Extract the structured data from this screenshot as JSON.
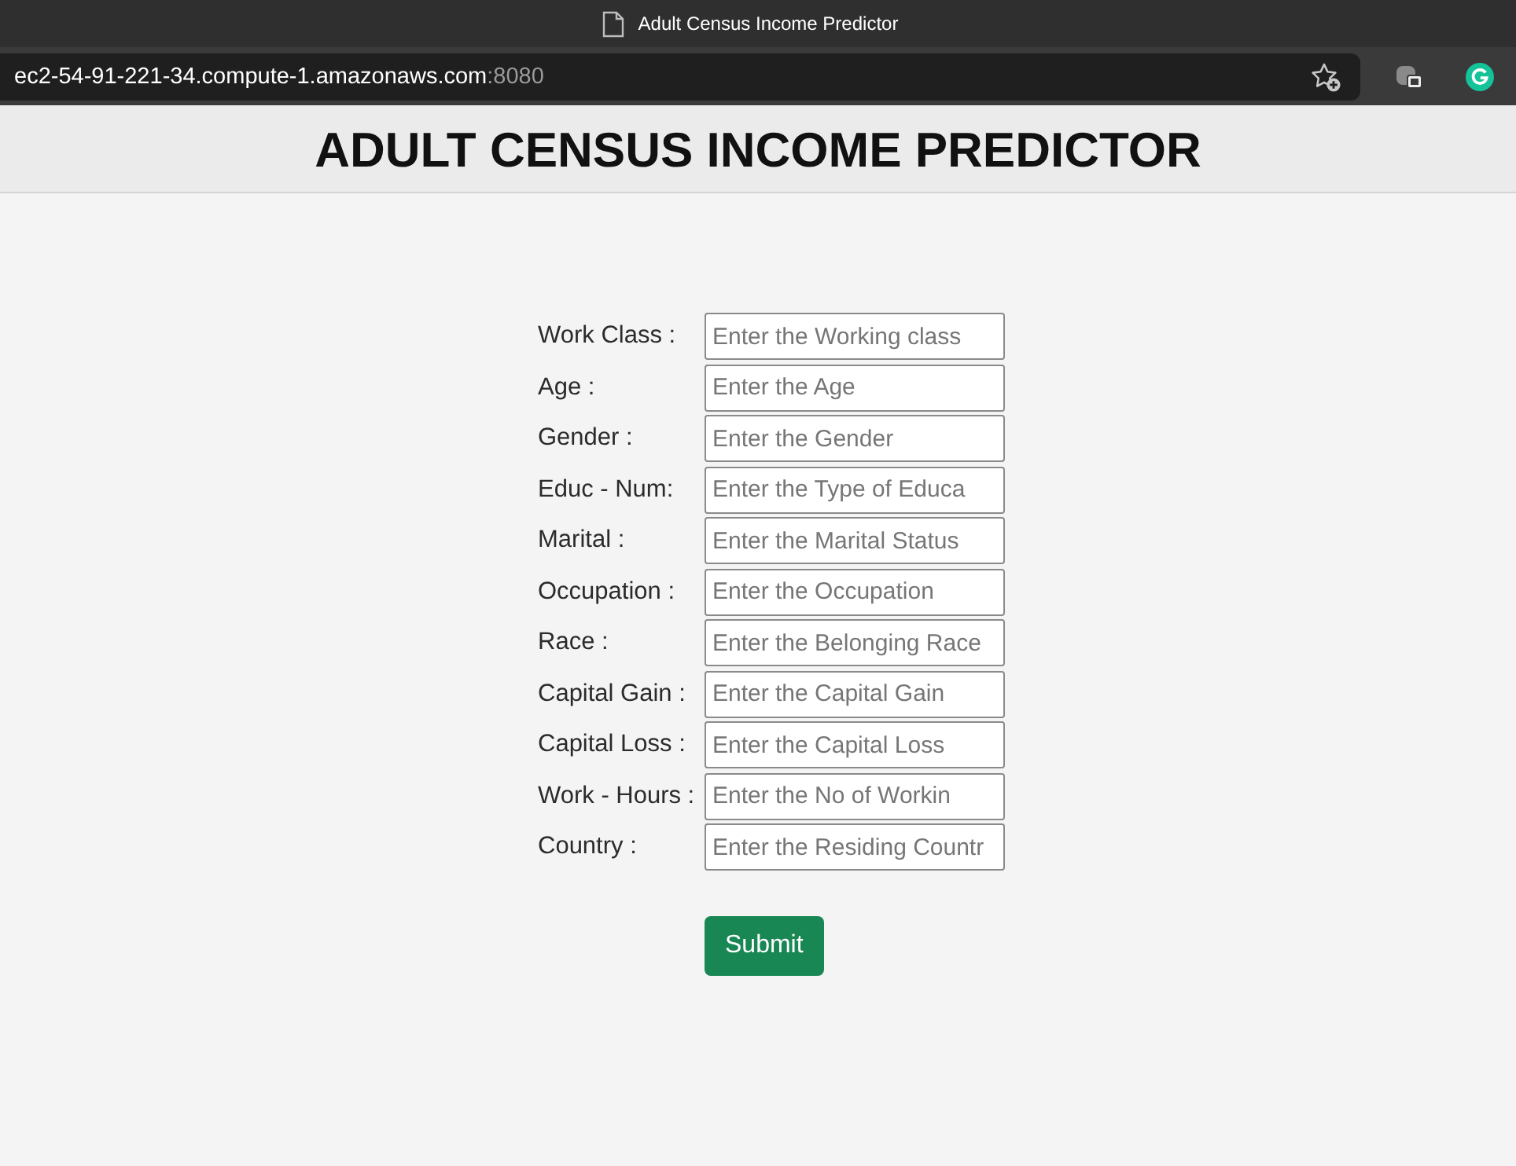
{
  "browser": {
    "tab_title": "Adult Census Income Predictor",
    "address": {
      "host": "ec2-54-91-221-34.compute-1.amazonaws.com",
      "port": ":8080"
    }
  },
  "header": {
    "title": "ADULT CENSUS INCOME PREDICTOR"
  },
  "form": {
    "fields": [
      {
        "label": "Work Class :",
        "placeholder": "Enter the Working class"
      },
      {
        "label": "Age :",
        "placeholder": "Enter the Age"
      },
      {
        "label": "Gender :",
        "placeholder": "Enter the Gender"
      },
      {
        "label": "Educ - Num:",
        "placeholder": "Enter the Type of Educa"
      },
      {
        "label": "Marital :",
        "placeholder": "Enter the Marital Status"
      },
      {
        "label": "Occupation :",
        "placeholder": "Enter the Occupation"
      },
      {
        "label": "Race :",
        "placeholder": "Enter the Belonging Race"
      },
      {
        "label": "Capital Gain :",
        "placeholder": "Enter the Capital Gain"
      },
      {
        "label": "Capital Loss :",
        "placeholder": "Enter the Capital Loss"
      },
      {
        "label": "Work - Hours :",
        "placeholder": "Enter the No of Workin"
      },
      {
        "label": "Country :",
        "placeholder": "Enter the Residing Countr"
      }
    ],
    "submit": "Submit"
  }
}
